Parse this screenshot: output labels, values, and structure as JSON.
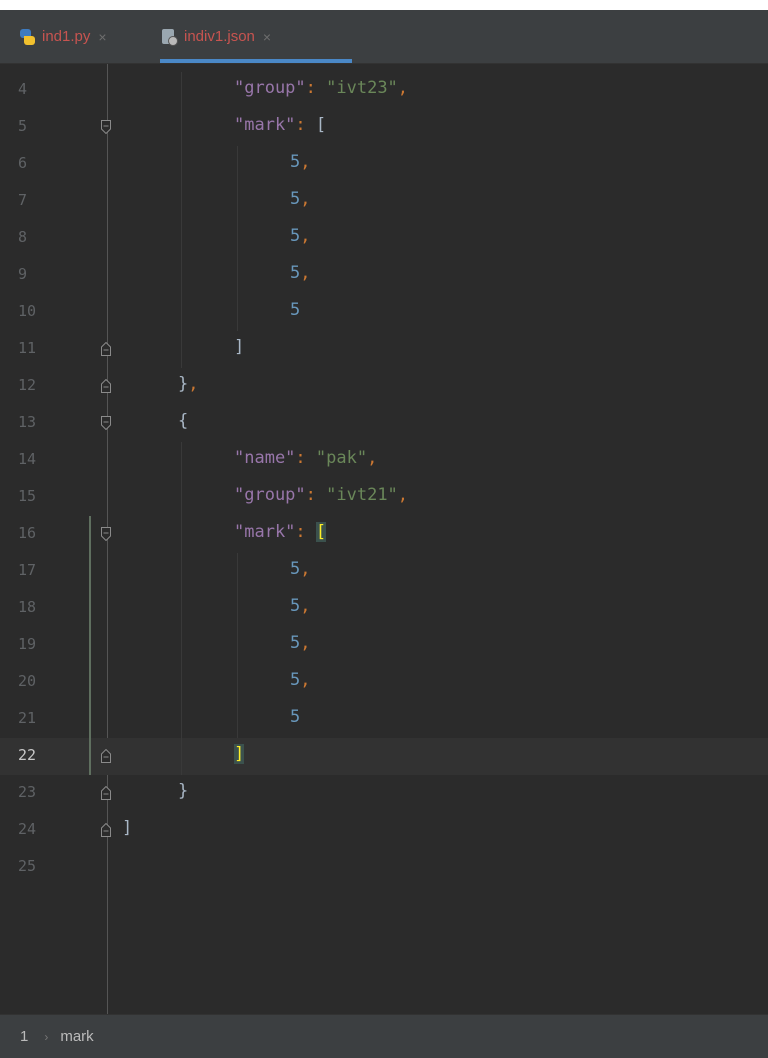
{
  "tabs": [
    {
      "label": "ind1.py",
      "close": "×",
      "icon": "python-file-icon"
    },
    {
      "label": "indiv1.json",
      "close": "×",
      "icon": "json-file-icon"
    }
  ],
  "lines": [
    {
      "num": "4",
      "indent": 8,
      "tokens": [
        [
          "k",
          "\"group\""
        ],
        [
          "p",
          ": "
        ],
        [
          "s",
          "\"ivt23\""
        ],
        [
          "p",
          ","
        ]
      ]
    },
    {
      "num": "5",
      "indent": 8,
      "tokens": [
        [
          "k",
          "\"mark\""
        ],
        [
          "p",
          ": "
        ],
        [
          "b",
          "["
        ]
      ]
    },
    {
      "num": "6",
      "indent": 12,
      "tokens": [
        [
          "n",
          "5"
        ],
        [
          "p",
          ","
        ]
      ]
    },
    {
      "num": "7",
      "indent": 12,
      "tokens": [
        [
          "n",
          "5"
        ],
        [
          "p",
          ","
        ]
      ]
    },
    {
      "num": "8",
      "indent": 12,
      "tokens": [
        [
          "n",
          "5"
        ],
        [
          "p",
          ","
        ]
      ]
    },
    {
      "num": "9",
      "indent": 12,
      "tokens": [
        [
          "n",
          "5"
        ],
        [
          "p",
          ","
        ]
      ]
    },
    {
      "num": "10",
      "indent": 12,
      "tokens": [
        [
          "n",
          "5"
        ]
      ]
    },
    {
      "num": "11",
      "indent": 8,
      "tokens": [
        [
          "b",
          "]"
        ]
      ]
    },
    {
      "num": "12",
      "indent": 4,
      "tokens": [
        [
          "b",
          "}"
        ],
        [
          "p",
          ","
        ]
      ]
    },
    {
      "num": "13",
      "indent": 4,
      "tokens": [
        [
          "b",
          "{"
        ]
      ]
    },
    {
      "num": "14",
      "indent": 8,
      "tokens": [
        [
          "k",
          "\"name\""
        ],
        [
          "p",
          ": "
        ],
        [
          "s",
          "\"pak\""
        ],
        [
          "p",
          ","
        ]
      ]
    },
    {
      "num": "15",
      "indent": 8,
      "tokens": [
        [
          "k",
          "\"group\""
        ],
        [
          "p",
          ": "
        ],
        [
          "s",
          "\"ivt21\""
        ],
        [
          "p",
          ","
        ]
      ]
    },
    {
      "num": "16",
      "indent": 8,
      "tokens": [
        [
          "k",
          "\"mark\""
        ],
        [
          "p",
          ": "
        ],
        [
          "bh",
          "["
        ]
      ]
    },
    {
      "num": "17",
      "indent": 12,
      "tokens": [
        [
          "n",
          "5"
        ],
        [
          "p",
          ","
        ]
      ]
    },
    {
      "num": "18",
      "indent": 12,
      "tokens": [
        [
          "n",
          "5"
        ],
        [
          "p",
          ","
        ]
      ]
    },
    {
      "num": "19",
      "indent": 12,
      "tokens": [
        [
          "n",
          "5"
        ],
        [
          "p",
          ","
        ]
      ]
    },
    {
      "num": "20",
      "indent": 12,
      "tokens": [
        [
          "n",
          "5"
        ],
        [
          "p",
          ","
        ]
      ]
    },
    {
      "num": "21",
      "indent": 12,
      "tokens": [
        [
          "n",
          "5"
        ]
      ]
    },
    {
      "num": "22",
      "indent": 8,
      "tokens": [
        [
          "bh",
          "]"
        ]
      ],
      "current": true
    },
    {
      "num": "23",
      "indent": 4,
      "tokens": [
        [
          "b",
          "}"
        ]
      ]
    },
    {
      "num": "24",
      "indent": 0,
      "tokens": [
        [
          "b",
          "]"
        ]
      ]
    },
    {
      "num": "25",
      "indent": 0,
      "tokens": []
    }
  ],
  "status": {
    "line": "1",
    "separator": "›",
    "breadcrumb": "mark"
  },
  "colors": {
    "keyword": "#9876aa",
    "string": "#6a8759",
    "punct": "#cc7832",
    "number": "#6897bb",
    "bracket_highlight": "#ffef28",
    "background": "#2b2b2b"
  }
}
